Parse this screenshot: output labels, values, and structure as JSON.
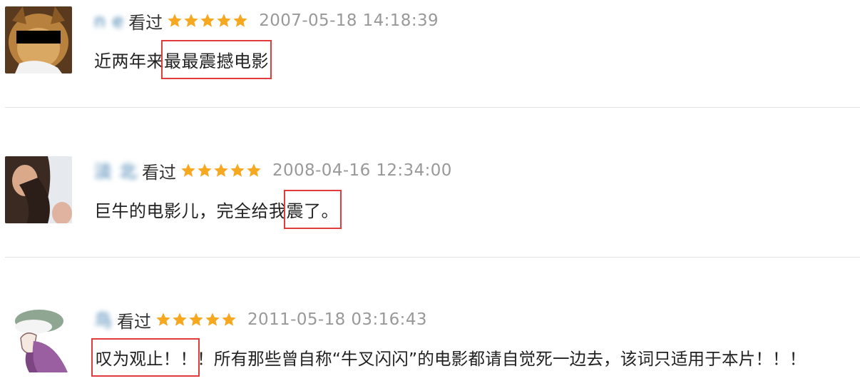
{
  "comments": [
    {
      "username": "n   e",
      "watched_label": "看过",
      "rating": 5,
      "time": "2007-05-18 14:18:39",
      "text_before": "近两年来",
      "text_marked": "最最震撼电影",
      "text_after": ""
    },
    {
      "username": "淡    北",
      "watched_label": "看过",
      "rating": 5,
      "time": "2008-04-16 12:34:00",
      "text_before": "巨牛的电影儿，完全给我",
      "text_marked": "震了。",
      "text_after": ""
    },
    {
      "username": "    鸟",
      "watched_label": "看过",
      "rating": 5,
      "time": "2011-05-18 03:16:43",
      "text_before": "",
      "text_marked": "叹为观止！！",
      "text_after": "！所有那些曾自称“牛叉闪闪”的电影都请自觉死一边去，该词只适用于本片！！！"
    }
  ],
  "colors": {
    "username": "#3377aa",
    "star": "#f7a821",
    "time": "#999999",
    "highlight_box": "#e23b3b"
  }
}
